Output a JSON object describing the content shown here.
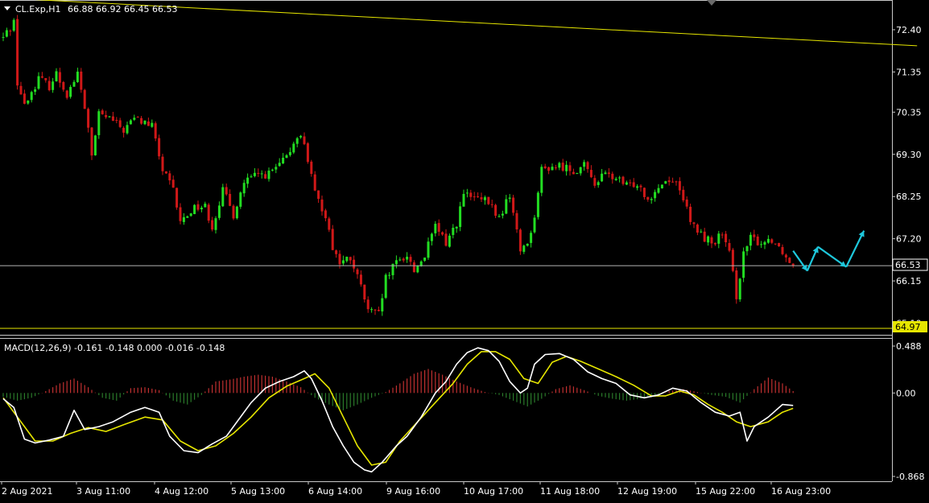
{
  "header": {
    "symbol": "CL.Exp,H1",
    "ohlc": "66.88 66.92 66.45 66.53",
    "macd_label": "MACD(12,26,9) -0.161 -0.148 0.000 -0.016 -0.148"
  },
  "price_badges": {
    "current": "66.53",
    "support": "64.97"
  },
  "colors": {
    "background": "#000000",
    "axis": "#c8c8c8",
    "bull": "#22dd22",
    "bear": "#d01818",
    "trendline": "#e6e600",
    "projection": "#1ec8dc",
    "macd_line": "#ffffff",
    "signal_line": "#e6e600",
    "hist_pos": "#c03030",
    "hist_neg": "#2a7a2a",
    "price_line": "#b4b4b4"
  },
  "chart_data": [
    {
      "type": "candlestick",
      "title": "CL.Exp,H1",
      "ylim": [
        64.85,
        73.1
      ],
      "y_ticks": [
        "72.40",
        "71.35",
        "70.35",
        "69.30",
        "68.25",
        "67.20",
        "66.15",
        "65.10"
      ],
      "x_tick_labels": [
        "2 Aug 2021",
        "3 Aug 11:00",
        "4 Aug 12:00",
        "5 Aug 13:00",
        "6 Aug 14:00",
        "9 Aug 16:00",
        "10 Aug 17:00",
        "11 Aug 18:00",
        "12 Aug 19:00",
        "15 Aug 22:00",
        "16 Aug 23:00"
      ],
      "bar_count": 240,
      "close_path": [
        [
          0,
          72.2
        ],
        [
          3,
          72.6
        ],
        [
          4,
          71.1
        ],
        [
          6,
          70.5
        ],
        [
          10,
          71.2
        ],
        [
          13,
          71.0
        ],
        [
          15,
          71.3
        ],
        [
          18,
          70.8
        ],
        [
          21,
          71.3
        ],
        [
          24,
          70.0
        ],
        [
          25,
          69.2
        ],
        [
          27,
          70.3
        ],
        [
          30,
          70.2
        ],
        [
          34,
          69.9
        ],
        [
          37,
          70.2
        ],
        [
          42,
          70.0
        ],
        [
          45,
          68.9
        ],
        [
          48,
          68.4
        ],
        [
          50,
          67.6
        ],
        [
          54,
          68.0
        ],
        [
          57,
          68.0
        ],
        [
          59,
          67.5
        ],
        [
          62,
          68.4
        ],
        [
          65,
          67.8
        ],
        [
          68,
          68.6
        ],
        [
          72,
          68.8
        ],
        [
          75,
          68.8
        ],
        [
          80,
          69.2
        ],
        [
          83,
          69.8
        ],
        [
          85,
          69.6
        ],
        [
          88,
          68.3
        ],
        [
          91,
          67.8
        ],
        [
          93,
          67.0
        ],
        [
          95,
          66.6
        ],
        [
          98,
          66.7
        ],
        [
          101,
          66.0
        ],
        [
          103,
          65.4
        ],
        [
          106,
          65.3
        ],
        [
          108,
          66.2
        ],
        [
          111,
          66.6
        ],
        [
          114,
          66.8
        ],
        [
          116,
          66.4
        ],
        [
          119,
          66.8
        ],
        [
          122,
          67.5
        ],
        [
          125,
          67.1
        ],
        [
          128,
          67.6
        ],
        [
          130,
          68.3
        ],
        [
          133,
          68.2
        ],
        [
          137,
          68.1
        ],
        [
          140,
          67.7
        ],
        [
          143,
          68.3
        ],
        [
          146,
          66.9
        ],
        [
          149,
          67.3
        ],
        [
          152,
          68.9
        ],
        [
          155,
          69.0
        ],
        [
          158,
          69.0
        ],
        [
          161,
          68.9
        ],
        [
          164,
          69.0
        ],
        [
          167,
          68.6
        ],
        [
          170,
          68.8
        ],
        [
          173,
          68.7
        ],
        [
          176,
          68.5
        ],
        [
          179,
          68.6
        ],
        [
          182,
          68.2
        ],
        [
          185,
          68.5
        ],
        [
          188,
          68.7
        ],
        [
          191,
          68.5
        ],
        [
          194,
          67.6
        ],
        [
          197,
          67.3
        ],
        [
          200,
          67.1
        ],
        [
          203,
          67.3
        ],
        [
          205,
          66.8
        ],
        [
          207,
          65.8
        ],
        [
          209,
          66.8
        ],
        [
          211,
          67.2
        ],
        [
          214,
          67.1
        ],
        [
          217,
          67.2
        ],
        [
          220,
          66.9
        ],
        [
          222,
          66.6
        ],
        [
          223,
          66.53
        ]
      ],
      "levels": {
        "current": 66.53,
        "support": 64.97
      },
      "trendline": [
        [
          -2,
          73.2
        ],
        [
          258,
          72.0
        ]
      ],
      "projection": [
        [
          223,
          66.9
        ],
        [
          227,
          66.4
        ],
        [
          230,
          67.0
        ],
        [
          238,
          66.5
        ],
        [
          243,
          67.4
        ]
      ]
    },
    {
      "type": "macd",
      "title": "MACD(12,26,9) -0.161 -0.148 0.000 -0.016 -0.148",
      "ylim": [
        -0.868,
        0.488
      ],
      "y_ticks": [
        "0.488",
        "0.00",
        "-0.868"
      ],
      "macd_path": [
        [
          0,
          -0.06
        ],
        [
          3,
          -0.15
        ],
        [
          6,
          -0.48
        ],
        [
          9,
          -0.52
        ],
        [
          13,
          -0.49
        ],
        [
          17,
          -0.45
        ],
        [
          20,
          -0.18
        ],
        [
          23,
          -0.38
        ],
        [
          27,
          -0.35
        ],
        [
          31,
          -0.3
        ],
        [
          36,
          -0.2
        ],
        [
          40,
          -0.15
        ],
        [
          44,
          -0.2
        ],
        [
          47,
          -0.45
        ],
        [
          51,
          -0.6
        ],
        [
          55,
          -0.62
        ],
        [
          59,
          -0.53
        ],
        [
          63,
          -0.45
        ],
        [
          66,
          -0.3
        ],
        [
          70,
          -0.1
        ],
        [
          74,
          0.05
        ],
        [
          78,
          0.12
        ],
        [
          82,
          0.17
        ],
        [
          85,
          0.23
        ],
        [
          87,
          0.15
        ],
        [
          90,
          -0.08
        ],
        [
          93,
          -0.35
        ],
        [
          96,
          -0.55
        ],
        [
          99,
          -0.72
        ],
        [
          102,
          -0.8
        ],
        [
          104,
          -0.82
        ],
        [
          107,
          -0.72
        ],
        [
          111,
          -0.55
        ],
        [
          114,
          -0.45
        ],
        [
          118,
          -0.25
        ],
        [
          122,
          0.0
        ],
        [
          125,
          0.12
        ],
        [
          128,
          0.3
        ],
        [
          131,
          0.42
        ],
        [
          134,
          0.47
        ],
        [
          137,
          0.44
        ],
        [
          140,
          0.33
        ],
        [
          143,
          0.12
        ],
        [
          146,
          0.0
        ],
        [
          148,
          0.05
        ],
        [
          150,
          0.3
        ],
        [
          153,
          0.4
        ],
        [
          157,
          0.41
        ],
        [
          161,
          0.35
        ],
        [
          165,
          0.22
        ],
        [
          169,
          0.15
        ],
        [
          173,
          0.1
        ],
        [
          177,
          -0.02
        ],
        [
          181,
          -0.05
        ],
        [
          185,
          -0.02
        ],
        [
          189,
          0.05
        ],
        [
          193,
          0.02
        ],
        [
          197,
          -0.1
        ],
        [
          201,
          -0.2
        ],
        [
          205,
          -0.24
        ],
        [
          208,
          -0.2
        ],
        [
          210,
          -0.5
        ],
        [
          212,
          -0.35
        ],
        [
          216,
          -0.25
        ],
        [
          220,
          -0.12
        ],
        [
          223,
          -0.13
        ]
      ],
      "signal_path": [
        [
          0,
          -0.05
        ],
        [
          5,
          -0.3
        ],
        [
          9,
          -0.5
        ],
        [
          14,
          -0.5
        ],
        [
          19,
          -0.42
        ],
        [
          24,
          -0.36
        ],
        [
          29,
          -0.4
        ],
        [
          34,
          -0.33
        ],
        [
          40,
          -0.25
        ],
        [
          45,
          -0.28
        ],
        [
          50,
          -0.5
        ],
        [
          55,
          -0.6
        ],
        [
          60,
          -0.55
        ],
        [
          65,
          -0.42
        ],
        [
          70,
          -0.25
        ],
        [
          75,
          -0.05
        ],
        [
          80,
          0.07
        ],
        [
          85,
          0.15
        ],
        [
          88,
          0.2
        ],
        [
          92,
          0.05
        ],
        [
          96,
          -0.25
        ],
        [
          100,
          -0.55
        ],
        [
          104,
          -0.75
        ],
        [
          108,
          -0.72
        ],
        [
          112,
          -0.5
        ],
        [
          117,
          -0.3
        ],
        [
          122,
          -0.1
        ],
        [
          127,
          0.1
        ],
        [
          131,
          0.3
        ],
        [
          135,
          0.43
        ],
        [
          139,
          0.43
        ],
        [
          143,
          0.35
        ],
        [
          147,
          0.15
        ],
        [
          151,
          0.1
        ],
        [
          155,
          0.32
        ],
        [
          159,
          0.38
        ],
        [
          163,
          0.33
        ],
        [
          168,
          0.25
        ],
        [
          173,
          0.17
        ],
        [
          178,
          0.08
        ],
        [
          183,
          -0.03
        ],
        [
          187,
          -0.03
        ],
        [
          191,
          0.02
        ],
        [
          195,
          -0.02
        ],
        [
          199,
          -0.12
        ],
        [
          203,
          -0.2
        ],
        [
          207,
          -0.3
        ],
        [
          211,
          -0.35
        ],
        [
          216,
          -0.3
        ],
        [
          220,
          -0.2
        ],
        [
          223,
          -0.16
        ]
      ],
      "histogram_path": [
        [
          0,
          -0.04
        ],
        [
          4,
          -0.08
        ],
        [
          8,
          -0.05
        ],
        [
          12,
          0.02
        ],
        [
          16,
          0.1
        ],
        [
          20,
          0.15
        ],
        [
          24,
          0.06
        ],
        [
          28,
          -0.05
        ],
        [
          32,
          -0.08
        ],
        [
          36,
          0.05
        ],
        [
          40,
          0.06
        ],
        [
          44,
          0.03
        ],
        [
          48,
          -0.08
        ],
        [
          52,
          -0.12
        ],
        [
          56,
          -0.02
        ],
        [
          60,
          0.12
        ],
        [
          64,
          0.14
        ],
        [
          68,
          0.17
        ],
        [
          72,
          0.19
        ],
        [
          76,
          0.17
        ],
        [
          80,
          0.12
        ],
        [
          84,
          0.06
        ],
        [
          88,
          -0.05
        ],
        [
          92,
          -0.12
        ],
        [
          96,
          -0.18
        ],
        [
          100,
          -0.12
        ],
        [
          104,
          -0.05
        ],
        [
          108,
          0.01
        ],
        [
          112,
          0.1
        ],
        [
          116,
          0.2
        ],
        [
          120,
          0.25
        ],
        [
          124,
          0.19
        ],
        [
          128,
          0.12
        ],
        [
          132,
          0.06
        ],
        [
          136,
          0.01
        ],
        [
          140,
          -0.02
        ],
        [
          144,
          -0.08
        ],
        [
          148,
          -0.14
        ],
        [
          152,
          -0.06
        ],
        [
          156,
          0.04
        ],
        [
          160,
          0.08
        ],
        [
          164,
          0.03
        ],
        [
          168,
          -0.03
        ],
        [
          172,
          -0.06
        ],
        [
          176,
          -0.08
        ],
        [
          180,
          -0.06
        ],
        [
          184,
          -0.04
        ],
        [
          188,
          0.02
        ],
        [
          192,
          0.04
        ],
        [
          196,
          0.01
        ],
        [
          200,
          -0.02
        ],
        [
          204,
          -0.04
        ],
        [
          208,
          -0.1
        ],
        [
          212,
          0.04
        ],
        [
          216,
          0.16
        ],
        [
          220,
          0.1
        ],
        [
          223,
          0.02
        ]
      ]
    }
  ]
}
